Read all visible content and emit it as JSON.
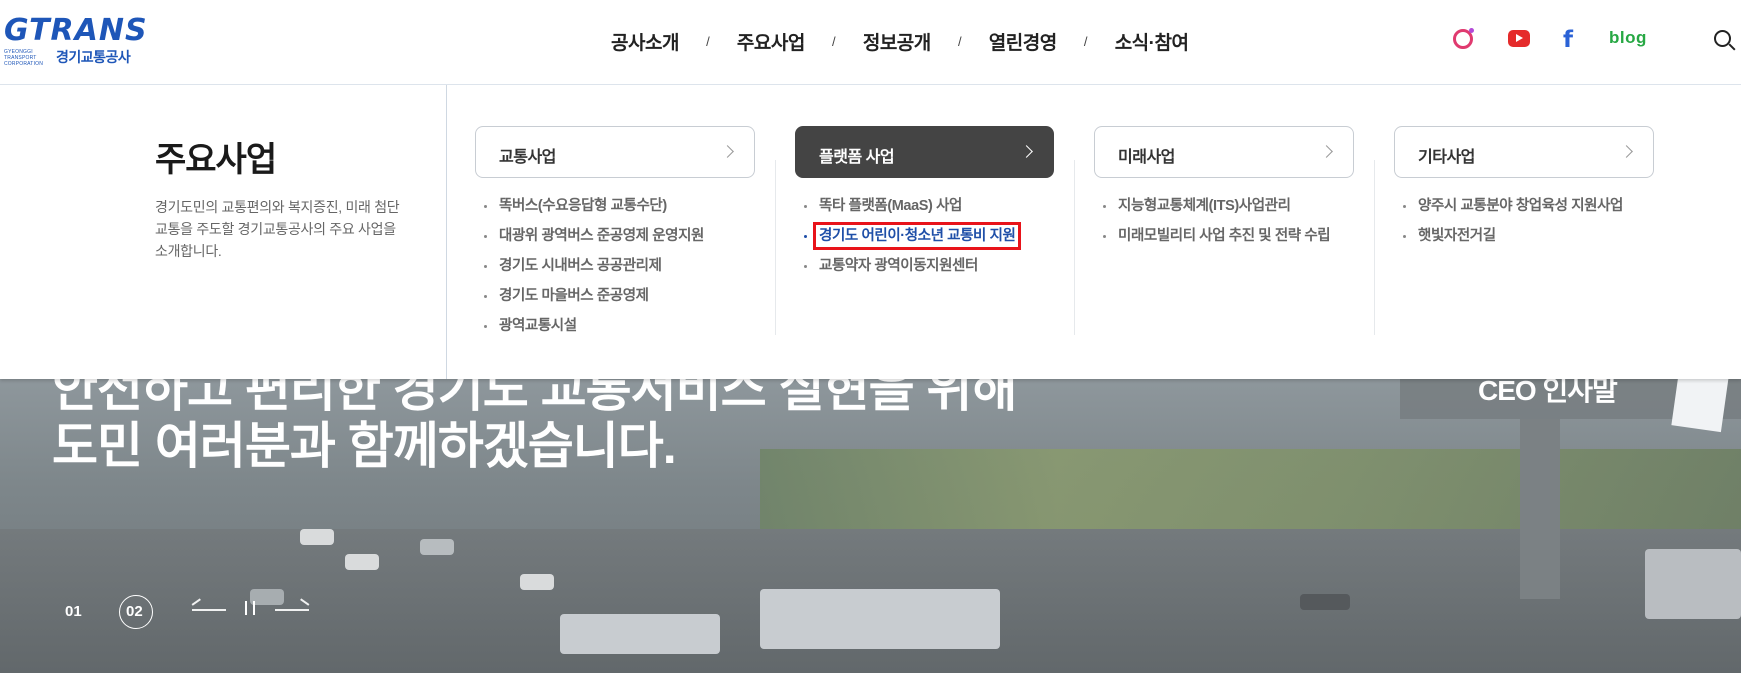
{
  "header": {
    "logo": {
      "mark": "GTRANS",
      "english": "GYEONGGI TRANSPORT CORPORATION",
      "korean": "경기교통공사"
    },
    "nav": [
      "공사소개",
      "주요사업",
      "정보공개",
      "열린경영",
      "소식·참여"
    ],
    "separator": "/",
    "sns": {
      "instagram_icon": "instagram-icon",
      "youtube_icon": "youtube-icon",
      "facebook": "f",
      "blog": "blog"
    },
    "search_icon": "search-icon"
  },
  "mega_menu": {
    "title": "주요사업",
    "description": "경기도민의 교통편의와 복지증진, 미래 첨단교통을 주도할 경기교통공사의 주요 사업을 소개합니다.",
    "columns": [
      {
        "label": "교통사업",
        "active": false,
        "items": [
          "똑버스(수요응답형 교통수단)",
          "대광위 광역버스 준공영제 운영지원",
          "경기도 시내버스 공공관리제",
          "경기도 마을버스 준공영제",
          "광역교통시설"
        ]
      },
      {
        "label": "플랫폼 사업",
        "active": true,
        "items": [
          "똑타 플랫폼(MaaS) 사업",
          "경기도 어린이·청소년 교통비 지원",
          "교통약자 광역이동지원센터"
        ],
        "highlighted_index": 1
      },
      {
        "label": "미래사업",
        "active": false,
        "items": [
          "지능형교통체계(ITS)사업관리",
          "미래모빌리티 사업 추진 및 전략 수립"
        ]
      },
      {
        "label": "기타사업",
        "active": false,
        "items": [
          "양주시 교통분야 창업육성 지원사업",
          "햇빛자전거길"
        ]
      }
    ],
    "colors": {
      "active_button": "#444444",
      "highlight_box": "#e8131a",
      "highlight_text": "#1f4fa8"
    }
  },
  "hero": {
    "line1": "안전하고 편리한 경기도 교통서비스 실현을 위해",
    "line2": "도민 여러분과 함께하겠습니다.",
    "ceo": "CEO 인사말",
    "pager": {
      "slides": [
        "01",
        "02"
      ],
      "current": "02"
    },
    "prev_icon": "arrow-left-icon",
    "next_icon": "arrow-right-icon",
    "pause_icon": "pause-icon"
  }
}
